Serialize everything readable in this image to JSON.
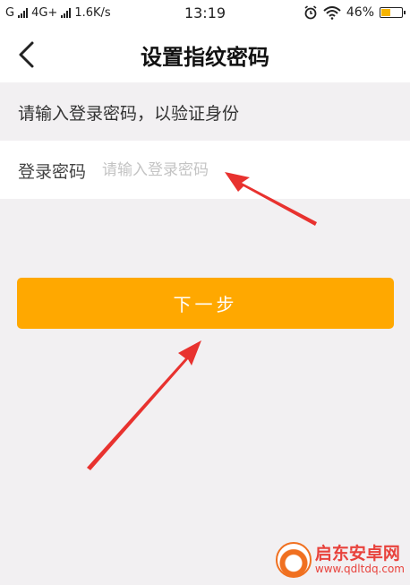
{
  "status_bar": {
    "carrier": "G",
    "network": "4G+",
    "speed": "1.6K/s",
    "time": "13:19",
    "battery": "46%",
    "battery_level": 0.46
  },
  "nav": {
    "title": "设置指纹密码"
  },
  "hint": "请输入登录密码，以验证身份",
  "form": {
    "label": "登录密码",
    "placeholder": "请输入登录密码",
    "value": ""
  },
  "next_button": "下一步",
  "watermark": {
    "name": "启东安卓网",
    "url": "www.qdltdq.com"
  },
  "colors": {
    "accent": "#ffa800",
    "annotation_arrow": "#e8322f"
  },
  "icons": {
    "back": "chevron-left-icon",
    "alarm": "alarm-icon",
    "wifi": "wifi-icon"
  }
}
